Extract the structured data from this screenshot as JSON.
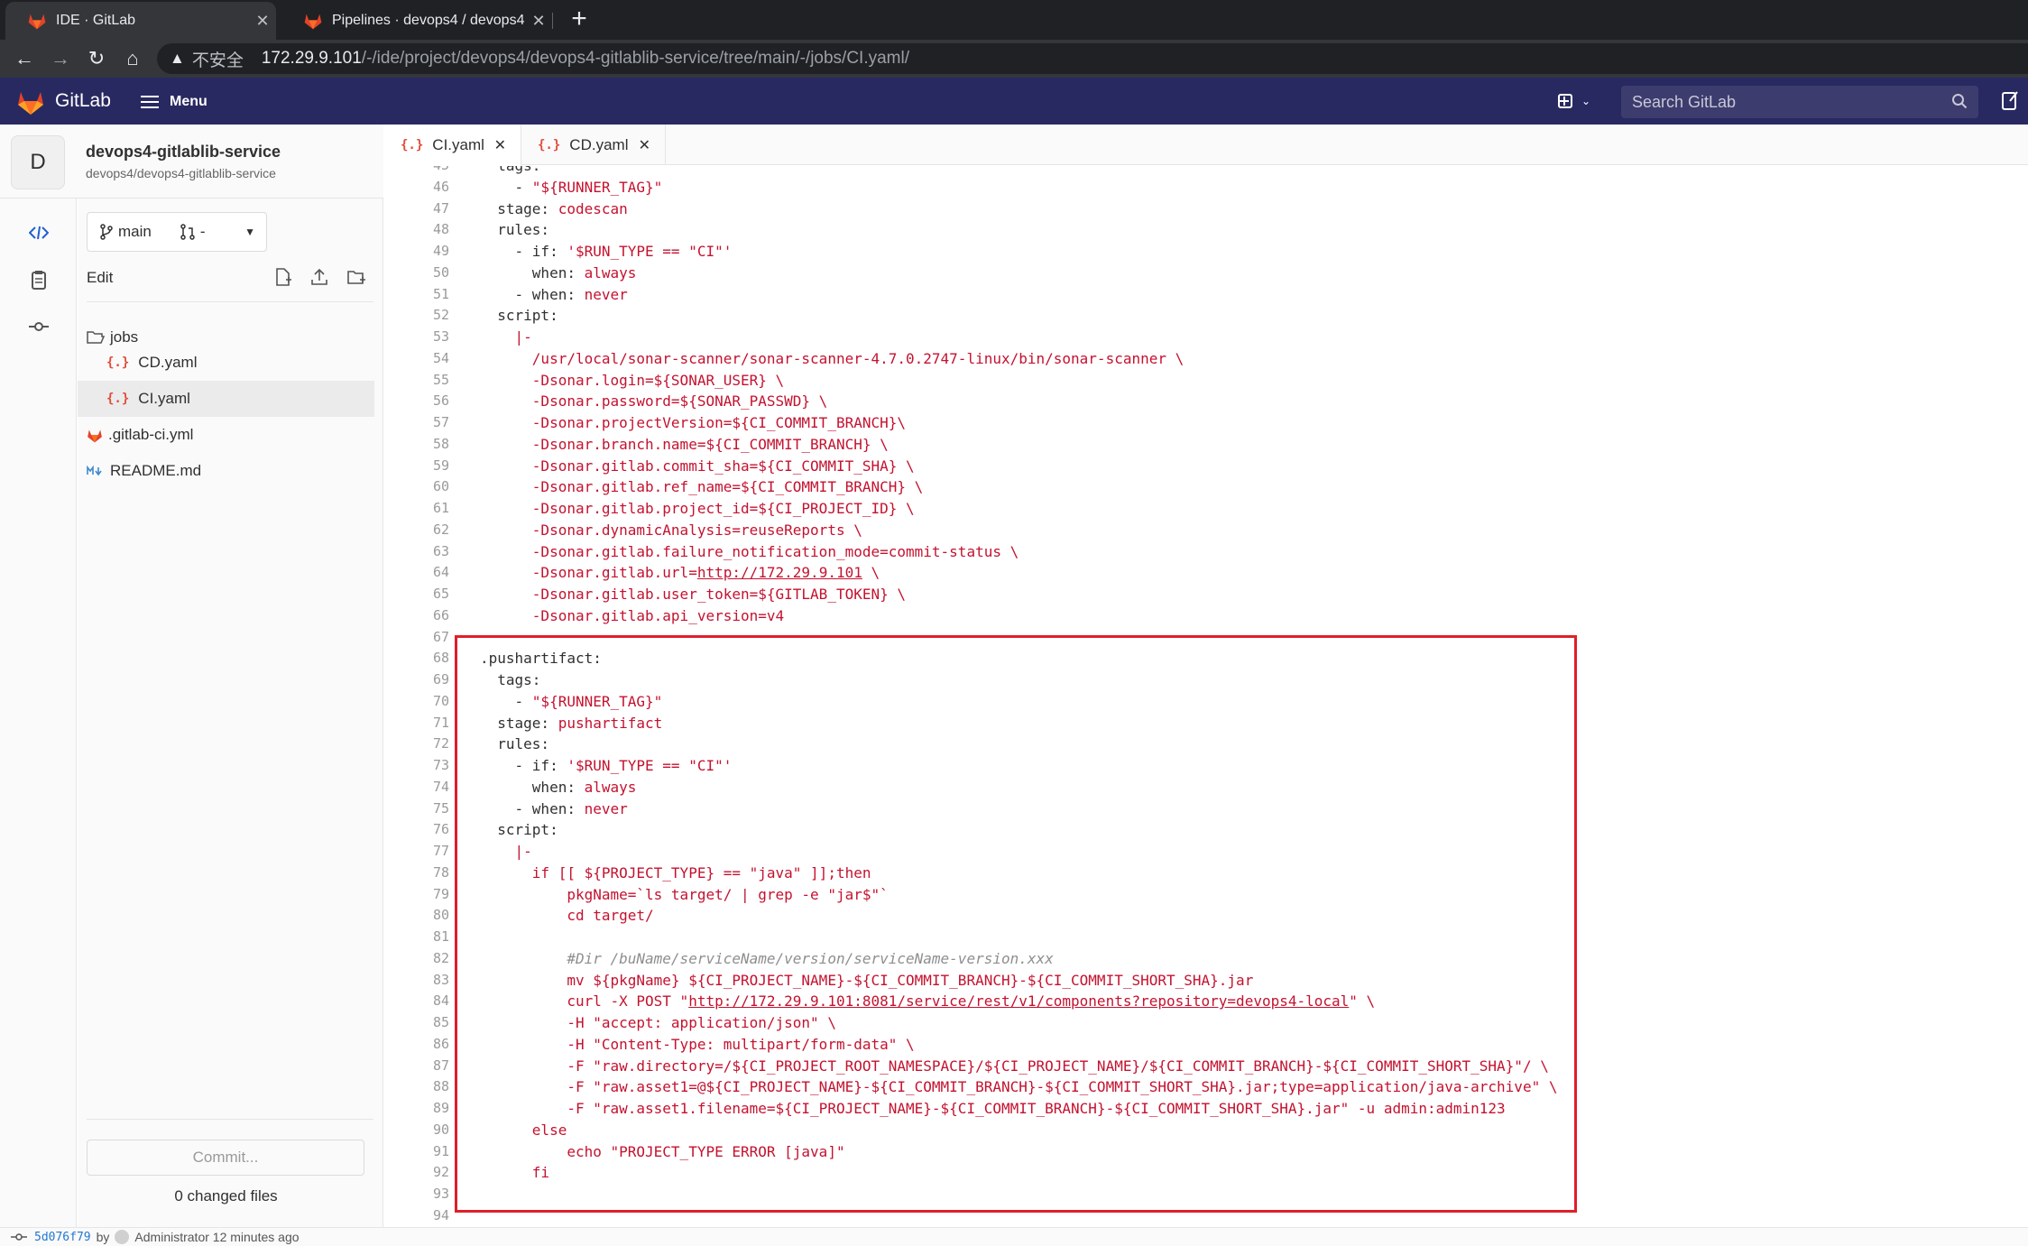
{
  "browser": {
    "tabs": [
      {
        "title": "IDE · GitLab",
        "active": true
      },
      {
        "title": "Pipelines · devops4 / devops4-",
        "active": false
      }
    ],
    "address": {
      "warning": "不安全",
      "host": "172.29.9.101",
      "path": "/-/ide/project/devops4/devops4-gitlablib-service/tree/main/-/jobs/CI.yaml/"
    }
  },
  "gitlab": {
    "brand": "GitLab",
    "menu_label": "Menu",
    "search_placeholder": "Search GitLab"
  },
  "project": {
    "avatar_letter": "D",
    "name": "devops4-gitlablib-service",
    "path": "devops4/devops4-gitlablib-service"
  },
  "tree": {
    "branch": "main",
    "mr_label": "-",
    "edit_label": "Edit",
    "items": [
      {
        "name": "jobs",
        "type": "folder"
      },
      {
        "name": "CD.yaml",
        "type": "yaml"
      },
      {
        "name": "CI.yaml",
        "type": "yaml",
        "selected": true
      },
      {
        "name": ".gitlab-ci.yml",
        "type": "gitlab"
      },
      {
        "name": "README.md",
        "type": "markdown"
      }
    ],
    "commit_button": "Commit...",
    "changed_files": "0 changed files"
  },
  "editor_tabs": [
    {
      "name": "CI.yaml",
      "active": true
    },
    {
      "name": "CD.yaml",
      "active": false
    }
  ],
  "code_lines": [
    {
      "n": "45",
      "t": "  tags:"
    },
    {
      "n": "46",
      "t": "    - \"${RUNNER_TAG}\""
    },
    {
      "n": "47",
      "t": "  stage: codescan"
    },
    {
      "n": "48",
      "t": "  rules:"
    },
    {
      "n": "49",
      "t": "    - if: '$RUN_TYPE == \"CI\"'"
    },
    {
      "n": "50",
      "t": "      when: always"
    },
    {
      "n": "51",
      "t": "    - when: never"
    },
    {
      "n": "52",
      "t": "  script:"
    },
    {
      "n": "53",
      "t": "    |-"
    },
    {
      "n": "54",
      "t": "      /usr/local/sonar-scanner/sonar-scanner-4.7.0.2747-linux/bin/sonar-scanner \\"
    },
    {
      "n": "55",
      "t": "      -Dsonar.login=${SONAR_USER} \\"
    },
    {
      "n": "56",
      "t": "      -Dsonar.password=${SONAR_PASSWD} \\"
    },
    {
      "n": "57",
      "t": "      -Dsonar.projectVersion=${CI_COMMIT_BRANCH}\\"
    },
    {
      "n": "58",
      "t": "      -Dsonar.branch.name=${CI_COMMIT_BRANCH} \\"
    },
    {
      "n": "59",
      "t": "      -Dsonar.gitlab.commit_sha=${CI_COMMIT_SHA} \\"
    },
    {
      "n": "60",
      "t": "      -Dsonar.gitlab.ref_name=${CI_COMMIT_BRANCH} \\"
    },
    {
      "n": "61",
      "t": "      -Dsonar.gitlab.project_id=${CI_PROJECT_ID} \\"
    },
    {
      "n": "62",
      "t": "      -Dsonar.dynamicAnalysis=reuseReports \\"
    },
    {
      "n": "63",
      "t": "      -Dsonar.gitlab.failure_notification_mode=commit-status \\"
    },
    {
      "n": "64",
      "t": "      -Dsonar.gitlab.url=http://172.29.9.101 \\"
    },
    {
      "n": "65",
      "t": "      -Dsonar.gitlab.user_token=${GITLAB_TOKEN} \\"
    },
    {
      "n": "66",
      "t": "      -Dsonar.gitlab.api_version=v4"
    },
    {
      "n": "67",
      "t": ""
    },
    {
      "n": "68",
      "t": ".pushartifact:"
    },
    {
      "n": "69",
      "t": "  tags:"
    },
    {
      "n": "70",
      "t": "    - \"${RUNNER_TAG}\""
    },
    {
      "n": "71",
      "t": "  stage: pushartifact"
    },
    {
      "n": "72",
      "t": "  rules:"
    },
    {
      "n": "73",
      "t": "    - if: '$RUN_TYPE == \"CI\"'"
    },
    {
      "n": "74",
      "t": "      when: always"
    },
    {
      "n": "75",
      "t": "    - when: never"
    },
    {
      "n": "76",
      "t": "  script:"
    },
    {
      "n": "77",
      "t": "    |-"
    },
    {
      "n": "78",
      "t": "      if [[ ${PROJECT_TYPE} == \"java\" ]];then"
    },
    {
      "n": "79",
      "t": "          pkgName=`ls target/ | grep -e \"jar$\"`"
    },
    {
      "n": "80",
      "t": "          cd target/"
    },
    {
      "n": "81",
      "t": ""
    },
    {
      "n": "82",
      "t": "          #Dir /buName/serviceName/version/serviceName-version.xxx"
    },
    {
      "n": "83",
      "t": "          mv ${pkgName} ${CI_PROJECT_NAME}-${CI_COMMIT_BRANCH}-${CI_COMMIT_SHORT_SHA}.jar"
    },
    {
      "n": "84",
      "t": "          curl -X POST \"http://172.29.9.101:8081/service/rest/v1/components?repository=devops4-local\" \\"
    },
    {
      "n": "85",
      "t": "          -H \"accept: application/json\" \\"
    },
    {
      "n": "86",
      "t": "          -H \"Content-Type: multipart/form-data\" \\"
    },
    {
      "n": "87",
      "t": "          -F \"raw.directory=/${CI_PROJECT_ROOT_NAMESPACE}/${CI_PROJECT_NAME}/${CI_COMMIT_BRANCH}-${CI_COMMIT_SHORT_SHA}\"/ \\"
    },
    {
      "n": "88",
      "t": "          -F \"raw.asset1=@${CI_PROJECT_NAME}-${CI_COMMIT_BRANCH}-${CI_COMMIT_SHORT_SHA}.jar;type=application/java-archive\" \\"
    },
    {
      "n": "89",
      "t": "          -F \"raw.asset1.filename=${CI_PROJECT_NAME}-${CI_COMMIT_BRANCH}-${CI_COMMIT_SHORT_SHA}.jar\" -u admin:admin123"
    },
    {
      "n": "90",
      "t": "      else"
    },
    {
      "n": "91",
      "t": "          echo \"PROJECT_TYPE ERROR [java]\""
    },
    {
      "n": "92",
      "t": "      fi"
    },
    {
      "n": "93",
      "t": ""
    },
    {
      "n": "94",
      "t": ""
    }
  ],
  "status": {
    "commit_sha": "5d076f79",
    "by": "by",
    "author_time": "Administrator 12 minutes ago"
  },
  "colors": {
    "gitlab_header": "#292961",
    "highlight_box": "#e01e2b",
    "yaml_value": "#c4122f"
  }
}
